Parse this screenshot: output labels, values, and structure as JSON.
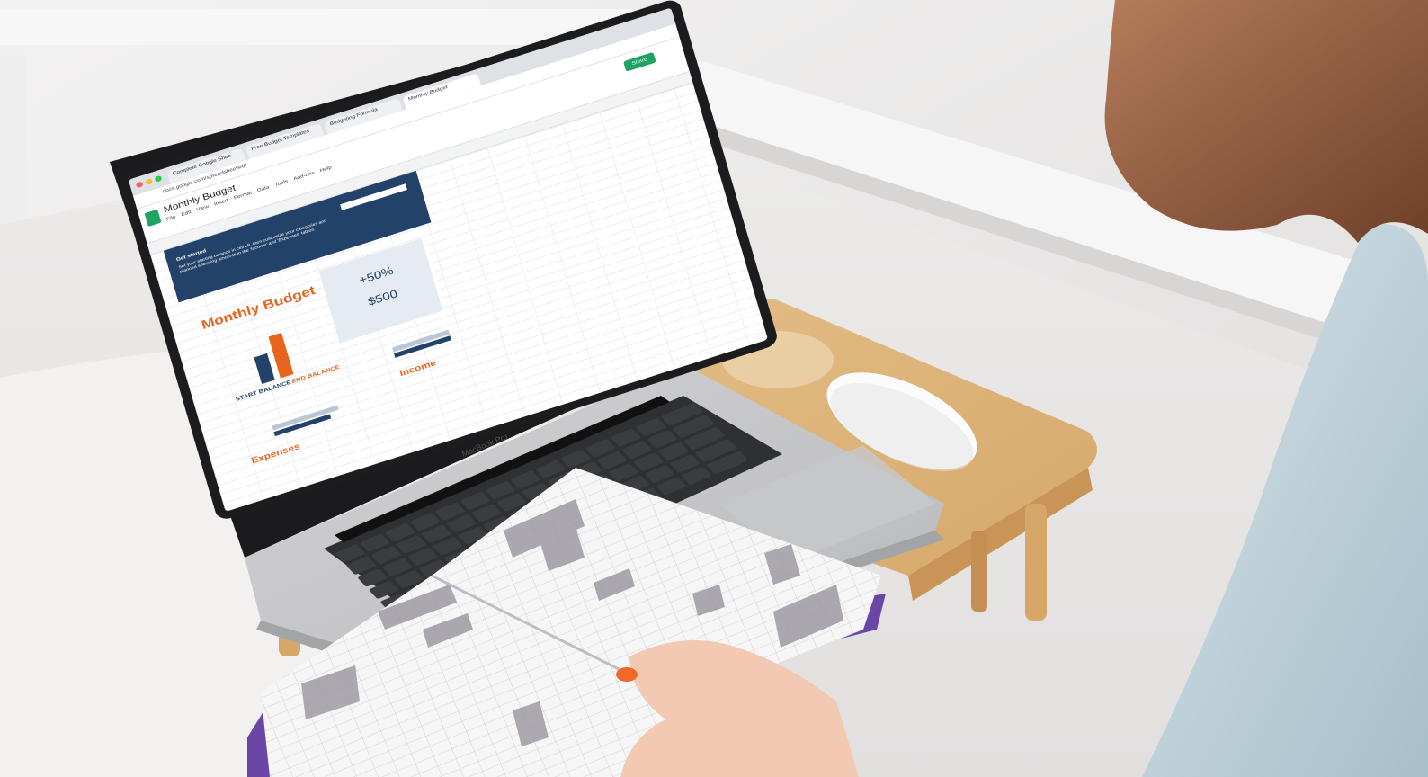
{
  "browser": {
    "tabs": [
      "Complete Google Shee",
      "Free Budget Templates",
      "Budgeting Formula",
      "Monthly Budget"
    ],
    "address": "docs.google.com/spreadsheets/d/"
  },
  "sheet": {
    "title": "Monthly Budget",
    "menu": [
      "File",
      "Edit",
      "View",
      "Insert",
      "Format",
      "Data",
      "Tools",
      "Add-ons",
      "Help"
    ],
    "share_label": "Share",
    "banner_title": "Get started",
    "banner_text": "Set your starting balance in cell L8, then customize your categories and planned spending amounts in the 'Income' and 'Expenses' tables.",
    "heading": "Monthly Budget",
    "start_label": "START BALANCE",
    "end_label": "END BALANCE",
    "percent": "+50%",
    "amount": "$500",
    "expenses_heading": "Expenses",
    "income_heading": "Income"
  },
  "laptop_label": "MacBook Pro",
  "colors": {
    "navy": "#23426a",
    "orange": "#e8641e",
    "sheets_green": "#1ea362"
  }
}
